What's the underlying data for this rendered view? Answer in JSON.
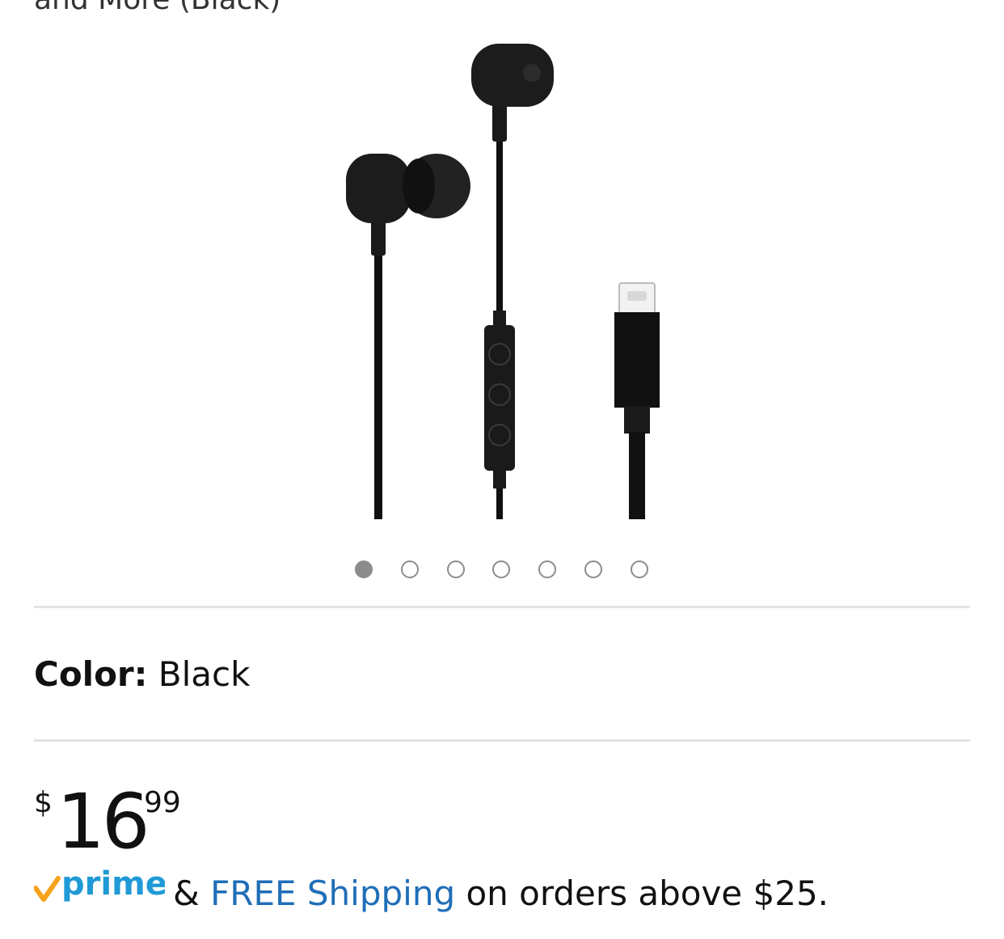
{
  "product": {
    "title_fragment": "and More (Black)",
    "image_icon": "earbuds-usb-c-product-image",
    "carousel": {
      "total": 7,
      "active_index": 0
    }
  },
  "variation": {
    "color_label": "Color:",
    "color_value": "Black"
  },
  "price": {
    "symbol": "$",
    "whole": "16",
    "fraction": "99"
  },
  "shipping": {
    "prime_logo_text": "prime",
    "ampersand": "&",
    "free_shipping_link": "FREE Shipping",
    "condition": "on orders above $25."
  },
  "colors": {
    "link_blue": "#1f6eb8",
    "prime_check_orange": "#f7a21b",
    "prime_text_blue": "#1f9ad6",
    "dot_gray": "#8c8c8c",
    "divider": "#e3e3e3"
  }
}
